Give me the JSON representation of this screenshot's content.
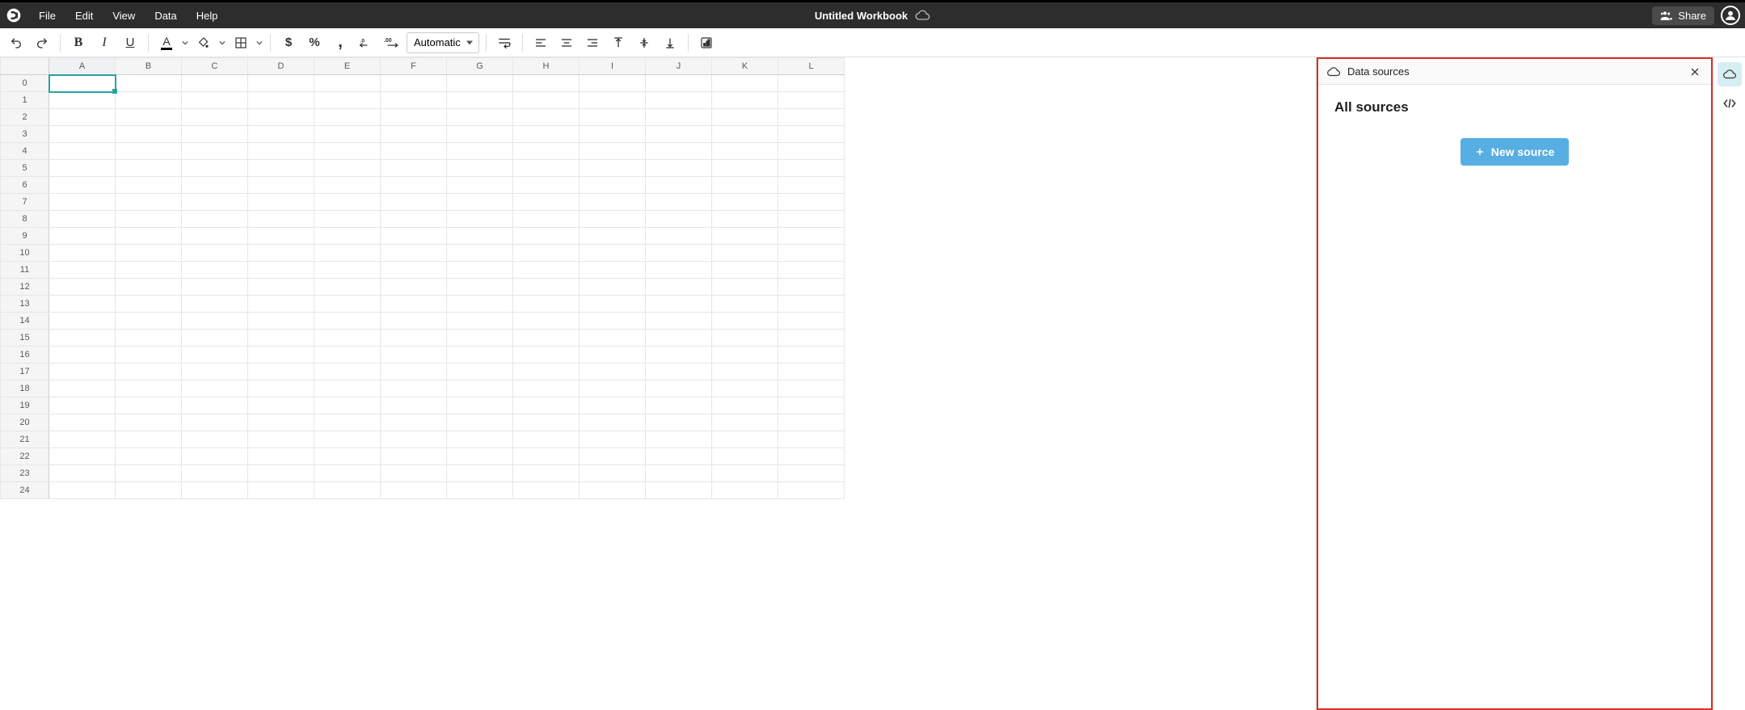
{
  "menu": {
    "file": "File",
    "edit": "Edit",
    "view": "View",
    "data": "Data",
    "help": "Help"
  },
  "title": "Untitled Workbook",
  "share": "Share",
  "toolbar": {
    "format": "Automatic"
  },
  "columns": [
    "A",
    "B",
    "C",
    "D",
    "E",
    "F",
    "G",
    "H",
    "I",
    "J",
    "K",
    "L"
  ],
  "rows": [
    "0",
    "1",
    "2",
    "3",
    "4",
    "5",
    "6",
    "7",
    "8",
    "9",
    "10",
    "11",
    "12",
    "13",
    "14",
    "15",
    "16",
    "17",
    "18",
    "19",
    "20",
    "21",
    "22",
    "23",
    "24"
  ],
  "selected_cell": {
    "row": 0,
    "col": 0,
    "value": ""
  },
  "panel": {
    "title": "Data sources",
    "heading": "All sources",
    "new_btn": "New source"
  }
}
